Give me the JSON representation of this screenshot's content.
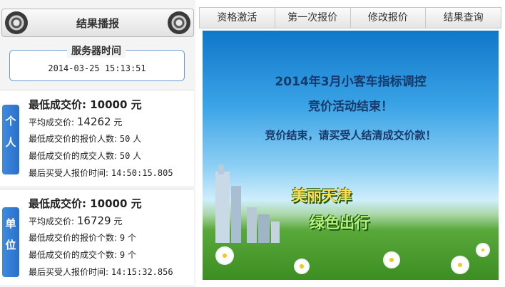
{
  "header": {
    "title": "结果播报"
  },
  "server": {
    "label": "服务器时间",
    "time": "2014-03-25 15:13:51"
  },
  "personal": {
    "tab": [
      "个",
      "人"
    ],
    "min_price_label": "最低成交价:",
    "min_price": "10000",
    "min_unit": "元",
    "avg_price_label": "平均成交价:",
    "avg_price": "14262",
    "avg_unit": "元",
    "min_bid_count_label": "最低成交价的报价人数:",
    "min_bid_count": "50",
    "min_bid_unit": "人",
    "min_deal_count_label": "最低成交价的成交人数:",
    "min_deal_count": "50",
    "min_deal_unit": "人",
    "last_time_label": "最后买受人报价时间:",
    "last_time": "14:50:15.805"
  },
  "unit": {
    "tab": [
      "单",
      "位"
    ],
    "min_price_label": "最低成交价:",
    "min_price": "10000",
    "min_unit": "元",
    "avg_price_label": "平均成交价:",
    "avg_price": "16729",
    "avg_unit": "元",
    "min_bid_count_label": "最低成交价的报价个数:",
    "min_bid_count": "9",
    "min_bid_unit": "个",
    "min_deal_count_label": "最低成交价的成交个数:",
    "min_deal_count": "9",
    "min_deal_unit": "个",
    "last_time_label": "最后买受人报价时间:",
    "last_time": "14:15:32.856"
  },
  "tabs": [
    "资格激活",
    "第一次报价",
    "修改报价",
    "结果查询"
  ],
  "banner": {
    "line1": "2014年3月小客车指标调控",
    "line2": "竞价活动结束！",
    "line3": "竞价结束，请买受人结清成交价款！",
    "slogan1": "美丽天津",
    "slogan2": "绿色出行"
  },
  "colors": {
    "accent_blue": "#2a6fc8",
    "banner_text": "#173a6a",
    "slogan_yellow": "#ffdd55",
    "slogan_green": "#b8f07a"
  }
}
